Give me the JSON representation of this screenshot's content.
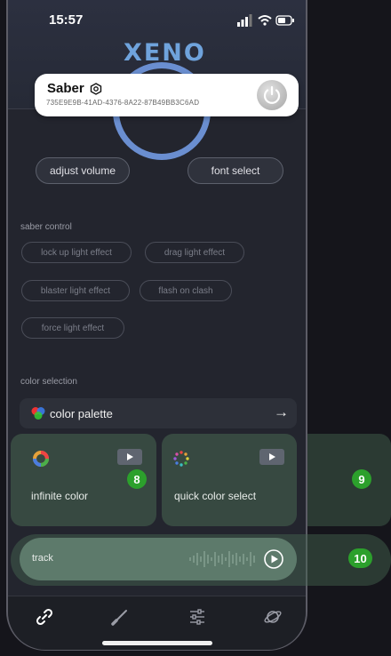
{
  "status": {
    "time": "15:57"
  },
  "logo": "XENO",
  "device": {
    "name": "Saber",
    "id": "735E9E9B-41AD-4376-8A22-87B49BB3C6AD"
  },
  "buttons": {
    "adjust_volume": "adjust volume",
    "font_select": "font select"
  },
  "saber_control": {
    "label": "saber control",
    "effects": [
      "lock up light effect",
      "drag light effect",
      "blaster light effect",
      "flash on clash",
      "force light effect"
    ]
  },
  "color_selection": {
    "label": "color selection",
    "palette_label": "color palette",
    "infinite_color": "infinite color",
    "quick_color_select": "quick color select"
  },
  "track": {
    "label": "track"
  },
  "badges": [
    "8",
    "9",
    "10"
  ],
  "colors": {
    "accent_green": "#2ca02c",
    "ring_blue": "#6a8ed0",
    "logo_blue": "#6fa3dc"
  },
  "tabs": [
    "link-icon",
    "saber-icon",
    "equalizer-icon",
    "planet-icon"
  ]
}
